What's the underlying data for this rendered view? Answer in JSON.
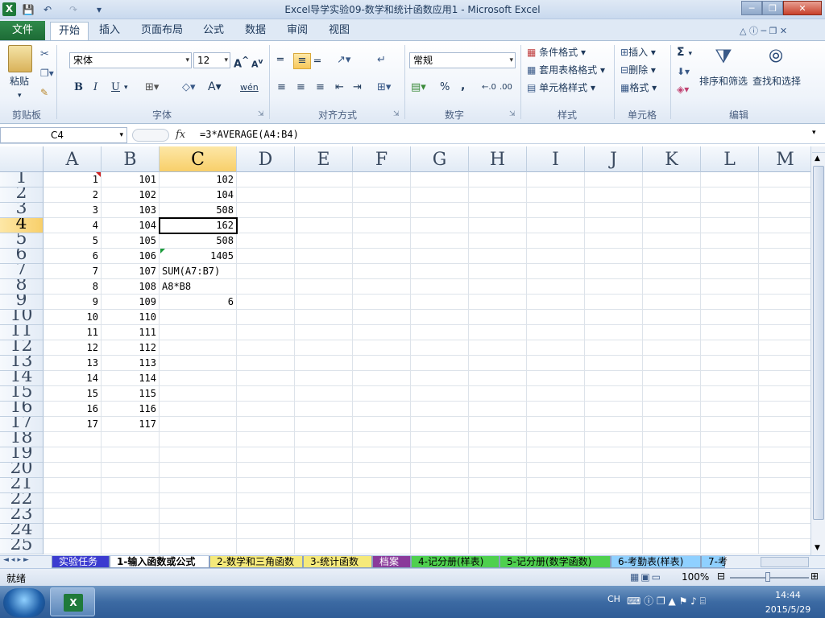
{
  "window": {
    "title": "Excel导学实验09-数学和统计函数应用1  -  Microsoft Excel",
    "app_icon_letter": "X",
    "qat": [
      "save-icon",
      "undo-icon",
      "redo-icon",
      "customize-icon"
    ],
    "controls": [
      "minimize",
      "restore",
      "close"
    ]
  },
  "ribbon_tabs": {
    "file": "文件",
    "tabs": [
      "开始",
      "插入",
      "页面布局",
      "公式",
      "数据",
      "审阅",
      "视图"
    ],
    "active_index": 0
  },
  "ribbon": {
    "clipboard": {
      "label": "剪贴板",
      "paste": "粘贴"
    },
    "font": {
      "label": "字体",
      "name": "宋体",
      "size": "12",
      "bold": "B",
      "italic": "I",
      "underline": "U",
      "phonetic": "wén"
    },
    "alignment": {
      "label": "对齐方式"
    },
    "number": {
      "label": "数字",
      "format": "常规",
      "percent": "%",
      "comma": ","
    },
    "styles": {
      "label": "样式",
      "conditional": "条件格式",
      "table": "套用表格格式",
      "cell_styles": "单元格样式"
    },
    "cells": {
      "label": "单元格",
      "insert": "插入",
      "delete": "删除",
      "format": "格式"
    },
    "editing": {
      "label": "编辑",
      "sum": "Σ",
      "sort": "排序和筛选",
      "find": "查找和选择"
    }
  },
  "formula_bar": {
    "name_box": "C4",
    "fx": "fx",
    "formula": "=3*AVERAGE(A4:B4)"
  },
  "columns": [
    "A",
    "B",
    "C",
    "D",
    "E",
    "F",
    "G",
    "H",
    "I",
    "J",
    "K",
    "L",
    "M"
  ],
  "selected": {
    "col": "C",
    "row": 4
  },
  "rows": [
    {
      "n": "1",
      "A": "1",
      "B": "101",
      "C": "102"
    },
    {
      "n": "2",
      "A": "2",
      "B": "102",
      "C": "104"
    },
    {
      "n": "3",
      "A": "3",
      "B": "103",
      "C": "508"
    },
    {
      "n": "4",
      "A": "4",
      "B": "104",
      "C": "162"
    },
    {
      "n": "5",
      "A": "5",
      "B": "105",
      "C": "508"
    },
    {
      "n": "6",
      "A": "6",
      "B": "106",
      "C": "1405"
    },
    {
      "n": "7",
      "A": "7",
      "B": "107",
      "C": "SUM(A7:B7)"
    },
    {
      "n": "8",
      "A": "8",
      "B": "108",
      "C": "A8*B8"
    },
    {
      "n": "9",
      "A": "9",
      "B": "109",
      "C": "6"
    },
    {
      "n": "10",
      "A": "10",
      "B": "110",
      "C": ""
    },
    {
      "n": "11",
      "A": "11",
      "B": "111",
      "C": ""
    },
    {
      "n": "12",
      "A": "12",
      "B": "112",
      "C": ""
    },
    {
      "n": "13",
      "A": "13",
      "B": "113",
      "C": ""
    },
    {
      "n": "14",
      "A": "14",
      "B": "114",
      "C": ""
    },
    {
      "n": "15",
      "A": "15",
      "B": "115",
      "C": ""
    },
    {
      "n": "16",
      "A": "16",
      "B": "116",
      "C": ""
    },
    {
      "n": "17",
      "A": "17",
      "B": "117",
      "C": ""
    },
    {
      "n": "18",
      "A": "",
      "B": "",
      "C": ""
    },
    {
      "n": "19",
      "A": "",
      "B": "",
      "C": ""
    },
    {
      "n": "20",
      "A": "",
      "B": "",
      "C": ""
    },
    {
      "n": "21",
      "A": "",
      "B": "",
      "C": ""
    },
    {
      "n": "22",
      "A": "",
      "B": "",
      "C": ""
    },
    {
      "n": "23",
      "A": "",
      "B": "",
      "C": ""
    },
    {
      "n": "24",
      "A": "",
      "B": "",
      "C": ""
    },
    {
      "n": "25",
      "A": "",
      "B": "",
      "C": ""
    }
  ],
  "sheet_tabs": [
    {
      "label": "实验任务",
      "color": "#3b3bd0"
    },
    {
      "label": "1-输入函数或公式",
      "color": "#ffffff"
    },
    {
      "label": "2-数学和三角函数",
      "color": "#f5e97a"
    },
    {
      "label": "3-统计函数",
      "color": "#f5e97a"
    },
    {
      "label": "档案",
      "color": "#8a3a9a"
    },
    {
      "label": "4-记分册(样表)",
      "color": "#4fd04f"
    },
    {
      "label": "5-记分册(数学函数)",
      "color": "#4fd04f"
    },
    {
      "label": "6-考勤表(样表)",
      "color": "#8fd0ff"
    },
    {
      "label": "7-考",
      "color": "#8fd0ff"
    }
  ],
  "status": {
    "ready": "就绪",
    "zoom": "100%"
  },
  "taskbar": {
    "lang": "CH",
    "time": "14:44",
    "date": "2015/5/29"
  }
}
